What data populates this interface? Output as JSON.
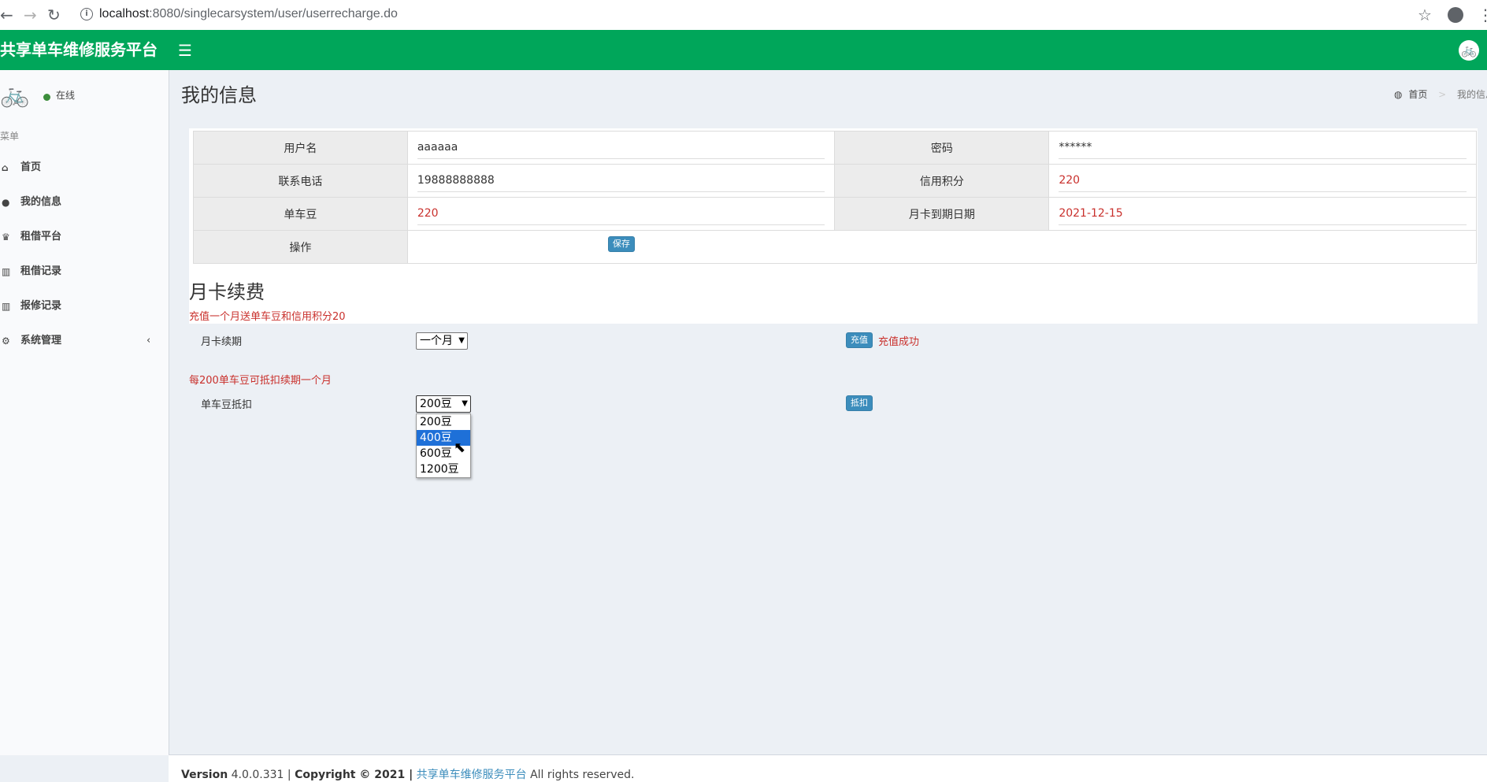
{
  "browser": {
    "url_host": "localhost",
    "url_rest": ":8080/singlecarsystem/user/userrecharge.do"
  },
  "header": {
    "logo": "共享单车维修服务平台",
    "toggle_icon": "hamburger-icon"
  },
  "sidebar": {
    "status": "在线",
    "menu_header": "菜单",
    "items": [
      {
        "label": "首页",
        "icon": "home-icon"
      },
      {
        "label": "我的信息",
        "icon": "user-icon"
      },
      {
        "label": "租借平台",
        "icon": "trophy-icon"
      },
      {
        "label": "租借记录",
        "icon": "bar-chart-icon"
      },
      {
        "label": "报修记录",
        "icon": "bar-chart-icon"
      },
      {
        "label": "系统管理",
        "icon": "gear-icon"
      }
    ]
  },
  "page": {
    "title": "我的信息",
    "breadcrumb": {
      "home": "首页",
      "current": "我的信息"
    }
  },
  "info_table": {
    "rows": [
      {
        "label1": "用户名",
        "value1": "aaaaaa",
        "label2": "密码",
        "value2": "******"
      },
      {
        "label1": "联系电话",
        "value1": "19888888888",
        "label2": "信用积分",
        "value2": "220"
      },
      {
        "label1": "单车豆",
        "value1": "220",
        "label2": "月卡到期日期",
        "value2": "2021-12-15"
      }
    ],
    "op_label": "操作",
    "save_label": "保存"
  },
  "renew": {
    "title": "月卡续费",
    "note": "充值一个月送单车豆和信用积分20",
    "period_label": "月卡续期",
    "period_value": "一个月",
    "recharge_label": "充值",
    "status": "充值成功"
  },
  "beans": {
    "note": "每200单车豆可抵扣续期一个月",
    "label": "单车豆抵扣",
    "selected": "200豆",
    "options": [
      "200豆",
      "400豆",
      "600豆",
      "1200豆"
    ],
    "highlighted": "400豆",
    "deduct_label": "抵扣"
  },
  "footer": {
    "version_label": "Version",
    "version": "4.0.0.331",
    "copyright": "Copyright © 2021 |",
    "brand": "共享单车维修服务平台",
    "rights": "All rights reserved."
  }
}
